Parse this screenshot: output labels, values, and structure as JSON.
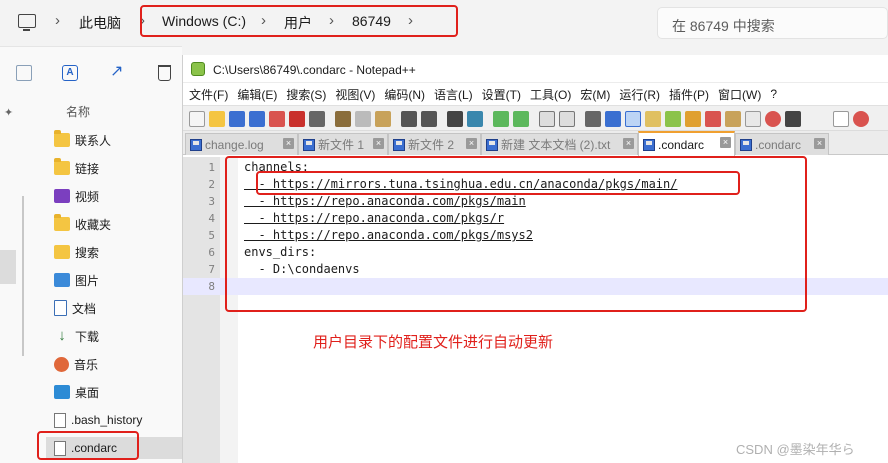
{
  "address_bar": {
    "breadcrumbs": [
      "此电脑",
      "Windows (C:)",
      "用户",
      "86749"
    ],
    "search_placeholder": "在 86749 中搜索"
  },
  "sidebar": {
    "column_header": "名称",
    "items": [
      {
        "label": "联系人",
        "icon": "folder-icon"
      },
      {
        "label": "链接",
        "icon": "folder-icon"
      },
      {
        "label": "视频",
        "icon": "video-folder-icon"
      },
      {
        "label": "收藏夹",
        "icon": "folder-icon"
      },
      {
        "label": "搜索",
        "icon": "search-folder-icon"
      },
      {
        "label": "图片",
        "icon": "pictures-folder-icon"
      },
      {
        "label": "文档",
        "icon": "documents-folder-icon"
      },
      {
        "label": "下载",
        "icon": "download-folder-icon"
      },
      {
        "label": "音乐",
        "icon": "music-folder-icon"
      },
      {
        "label": "桌面",
        "icon": "desktop-folder-icon"
      },
      {
        "label": ".bash_history",
        "icon": "file-icon"
      },
      {
        "label": ".condarc",
        "icon": "file-icon",
        "selected": true
      }
    ]
  },
  "notepad": {
    "title": "C:\\Users\\86749\\.condarc - Notepad++",
    "menu": [
      "文件(F)",
      "编辑(E)",
      "搜索(S)",
      "视图(V)",
      "编码(N)",
      "语言(L)",
      "设置(T)",
      "工具(O)",
      "宏(M)",
      "运行(R)",
      "插件(P)",
      "窗口(W)",
      "?"
    ],
    "tabs": [
      {
        "label": "change.log",
        "active": false
      },
      {
        "label": "新文件 1",
        "active": false
      },
      {
        "label": "新文件 2",
        "active": false
      },
      {
        "label": "新建 文本文档 (2).txt",
        "active": false
      },
      {
        "label": ".condarc",
        "active": true
      },
      {
        "label": ".condarc",
        "active": false
      }
    ],
    "lines": [
      {
        "num": "1",
        "text": "channels:"
      },
      {
        "num": "2",
        "text": "  - https://mirrors.tuna.tsinghua.edu.cn/anaconda/pkgs/main/"
      },
      {
        "num": "3",
        "text": "  - https://repo.anaconda.com/pkgs/main"
      },
      {
        "num": "4",
        "text": "  - https://repo.anaconda.com/pkgs/r"
      },
      {
        "num": "5",
        "text": "  - https://repo.anaconda.com/pkgs/msys2"
      },
      {
        "num": "6",
        "text": "envs_dirs:"
      },
      {
        "num": "7",
        "text": "  - D:\\condaenvs"
      },
      {
        "num": "8",
        "text": ""
      }
    ]
  },
  "annotation": "用户目录下的配置文件进行自动更新",
  "watermark": "CSDN @墨染年华ら",
  "colors": {
    "annotation_red": "#e0201b",
    "current_line": "#e8e8ff",
    "active_tab_accent": "#f0a030"
  }
}
